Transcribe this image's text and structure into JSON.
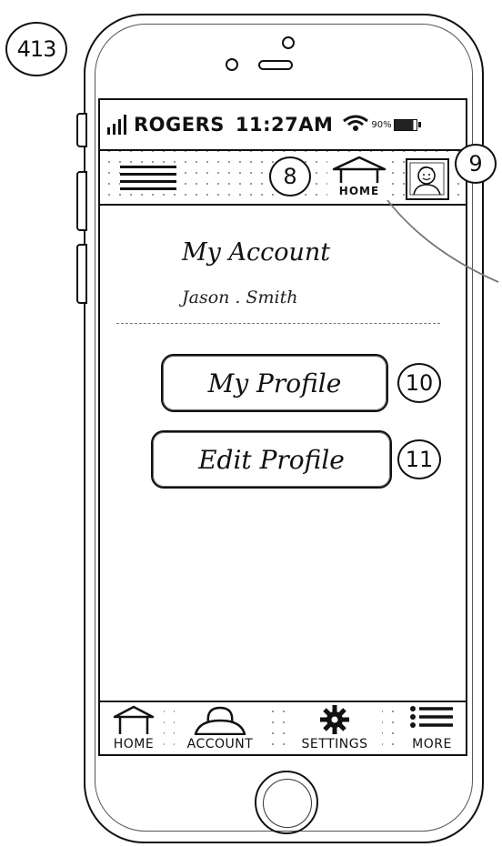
{
  "page_tag": "413",
  "status_bar": {
    "carrier": "ROGERS",
    "time": "11:27AM",
    "battery_percent": "90%"
  },
  "header": {
    "home_label": "HOME"
  },
  "callouts": {
    "header": "8",
    "avatar": "9",
    "my_profile": "10",
    "edit_profile": "11"
  },
  "account": {
    "title": "My Account",
    "name": "Jason . Smith"
  },
  "buttons": {
    "my_profile": "My Profile",
    "edit_profile": "Edit Profile"
  },
  "bottom_nav": {
    "home": "HOME",
    "account": "ACCOUNT",
    "settings": "SETTINGS",
    "more": "MORE"
  },
  "icons": [
    "menu-icon",
    "house-icon",
    "avatar-icon",
    "user-icon",
    "gear-icon",
    "list-icon",
    "wifi-icon",
    "signal-icon",
    "battery-icon"
  ]
}
